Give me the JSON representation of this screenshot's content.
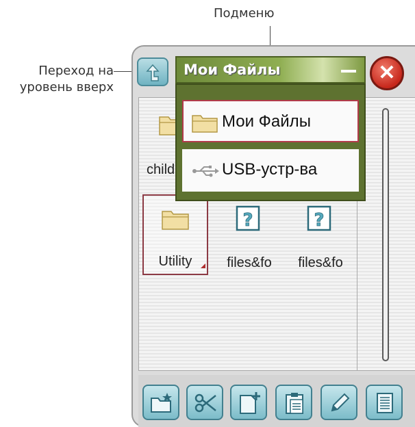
{
  "annotations": {
    "submenu": "Подменю",
    "up_line1": "Переход на",
    "up_line2": "уровень вверх"
  },
  "window": {
    "title": "Мои Файлы"
  },
  "submenu": {
    "items": [
      {
        "label": "Мои Файлы",
        "icon": "folder-icon",
        "selected": true
      },
      {
        "label": "USB-устр-ва",
        "icon": "usb-icon",
        "selected": false
      }
    ]
  },
  "files": [
    {
      "label": "child",
      "icon": "folder-icon"
    },
    {
      "label": "Utility",
      "icon": "folder-icon",
      "selected": true
    },
    {
      "label": "files&fo",
      "icon": "unknown-file-icon"
    },
    {
      "label": "files&fo",
      "icon": "unknown-file-icon"
    }
  ],
  "toolbar": {
    "buttons": [
      "new-folder-icon",
      "cut-icon",
      "new-file-icon",
      "paste-icon",
      "edit-icon",
      "properties-icon"
    ]
  },
  "colors": {
    "title_bar": "#8fae52",
    "selection_border": "#b23a4a",
    "button_accent": "#7cbcc9",
    "close_button": "#c7281c"
  }
}
